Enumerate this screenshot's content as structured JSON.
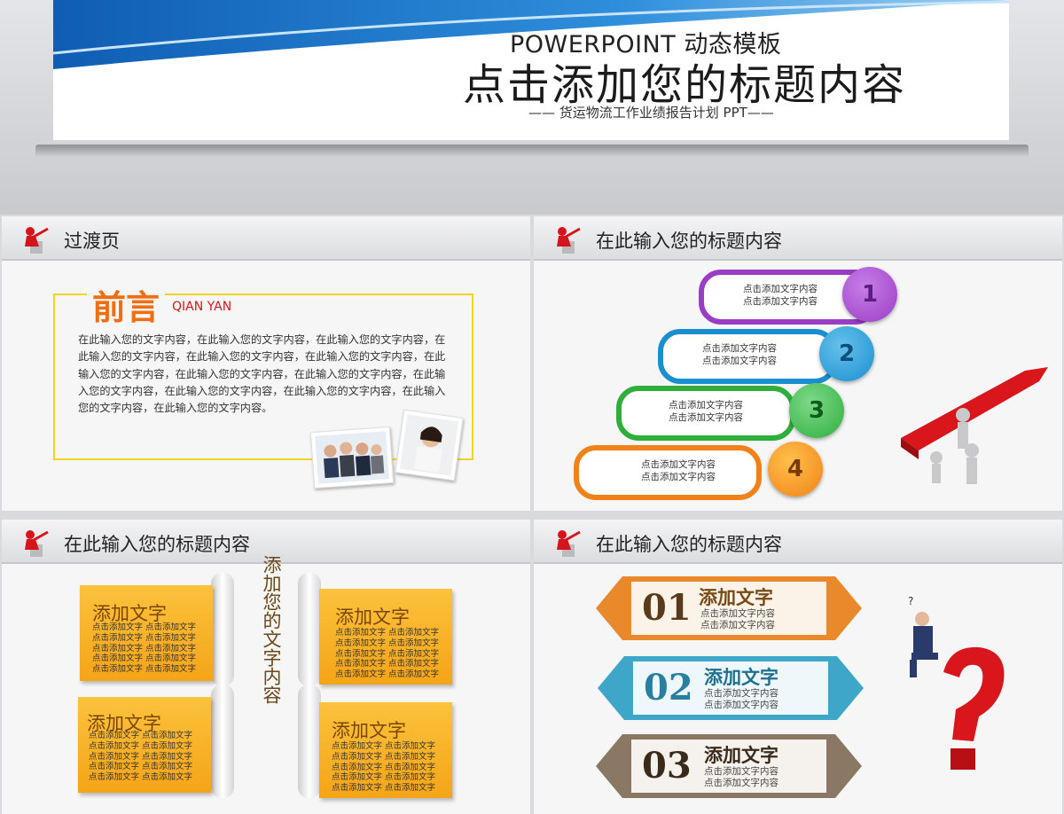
{
  "cover": {
    "en_title": "POWERPOINT 动态模板",
    "title": "点击添加您的标题内容",
    "subtitle": "—— 货运物流工作业绩报告计划 PPT——",
    "accent": "#1a6fc4"
  },
  "panel1": {
    "header": "过渡页",
    "heading_cn": "前言",
    "heading_en": "QIAN YAN",
    "body": "在此输入您的文字内容，在此输入您的文字内容，在此输入您的文字内容，在此输入您的文字内容，在此输入您的文字内容，在此输入您的文字内容，在此输入您的文字内容，在此输入您的文字内容，在此输入您的文字内容，在此输入您的文字内容，在此输入您的文字内容，在此输入您的文字内容，在此输入您的文字内容，在此输入您的文字内容。",
    "colors": {
      "heading": "#f06d10",
      "en": "#d7161c",
      "frame": "#f1d324"
    }
  },
  "panel2": {
    "header": "在此输入您的标题内容",
    "steps": [
      {
        "num": "1",
        "line1": "点击添加文字内容",
        "line2": "点击添加文字内容",
        "color": "#9b3cc6"
      },
      {
        "num": "2",
        "line1": "点击添加文字内容",
        "line2": "点击添加文字内容",
        "color": "#1a8fd0"
      },
      {
        "num": "3",
        "line1": "点击添加文字内容",
        "line2": "点击添加文字内容",
        "color": "#2fae3c"
      },
      {
        "num": "4",
        "line1": "点击添加文字内容",
        "line2": "点击添加文字内容",
        "color": "#f08219"
      }
    ]
  },
  "panel3": {
    "header": "在此输入您的标题内容",
    "vertical": "添加您的文字内容",
    "cards": [
      {
        "title": "添加文字",
        "line": "点击添加文字 点击添加文字"
      },
      {
        "title": "添加文字",
        "line": "点击添加文字 点击添加文字"
      },
      {
        "title": "添加文字",
        "line": "点击添加文字 点击添加文字"
      },
      {
        "title": "添加文字",
        "line": "点击添加文字 点击添加文字"
      }
    ]
  },
  "panel4": {
    "header": "在此输入您的标题内容",
    "items": [
      {
        "num": "01",
        "title": "添加文字",
        "line1": "点击添加文字内容",
        "line2": "点击添加文字内容",
        "color": "#e9892c",
        "num_color": "#5a3a1a"
      },
      {
        "num": "02",
        "title": "添加文字",
        "line1": "点击添加文字内容",
        "line2": "点击添加文字内容",
        "color": "#3ea7c9",
        "num_color": "#2a7ea0"
      },
      {
        "num": "03",
        "title": "添加文字",
        "line1": "点击添加文字内容",
        "line2": "点击添加文字内容",
        "color": "#8a7864",
        "num_color": "#3a2a1a"
      }
    ]
  }
}
